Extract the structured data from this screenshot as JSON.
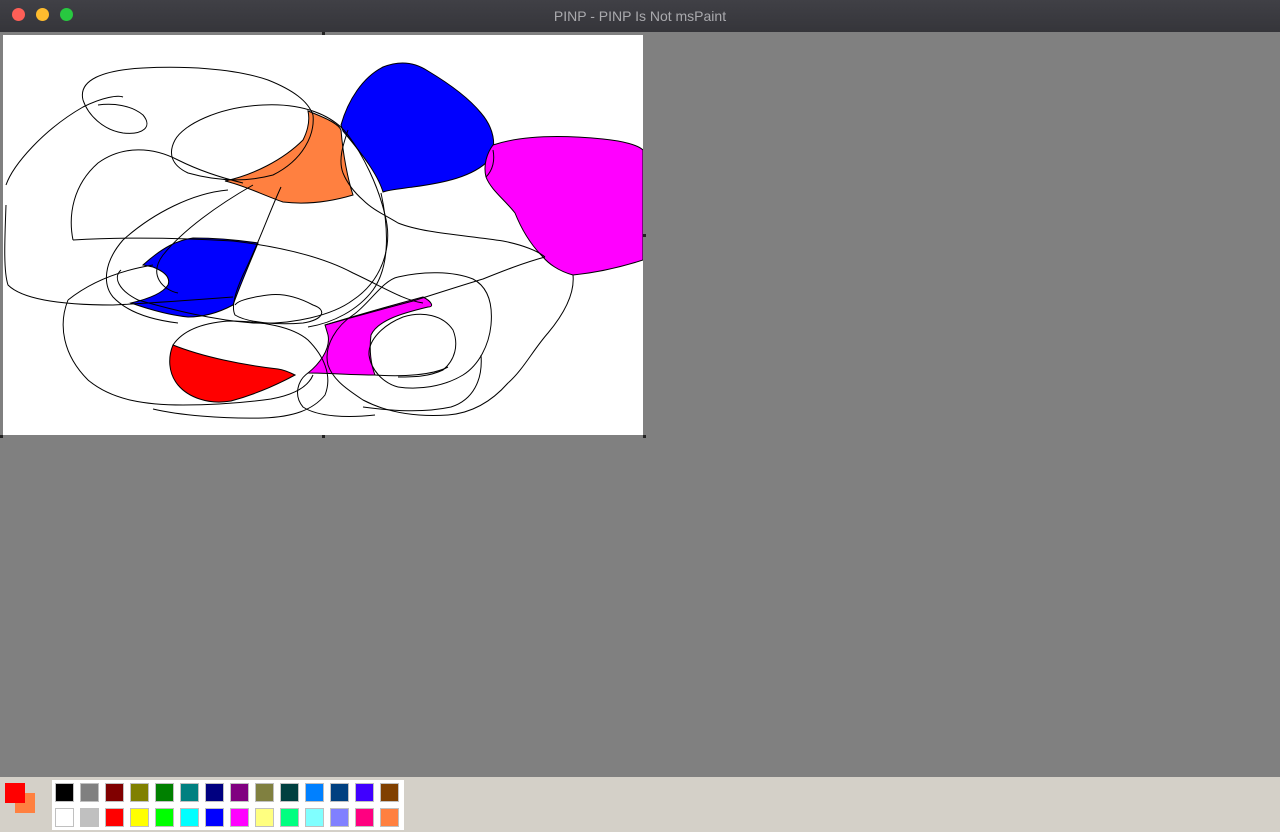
{
  "window": {
    "title": "PINP - PINP Is Not msPaint"
  },
  "colors": {
    "foreground": "#ff0000",
    "background": "#ff8040"
  },
  "palette": {
    "top_row": [
      "#000000",
      "#808080",
      "#800000",
      "#808000",
      "#008000",
      "#008080",
      "#000080",
      "#800080",
      "#808040",
      "#004040",
      "#0080ff",
      "#004080",
      "#4000ff",
      "#804000"
    ],
    "bottom_row": [
      "#ffffff",
      "#c0c0c0",
      "#ff0000",
      "#ffff00",
      "#00ff00",
      "#00ffff",
      "#0000ff",
      "#ff00ff",
      "#ffff80",
      "#00ff80",
      "#80ffff",
      "#8080ff",
      "#ff0080",
      "#ff8040"
    ]
  }
}
